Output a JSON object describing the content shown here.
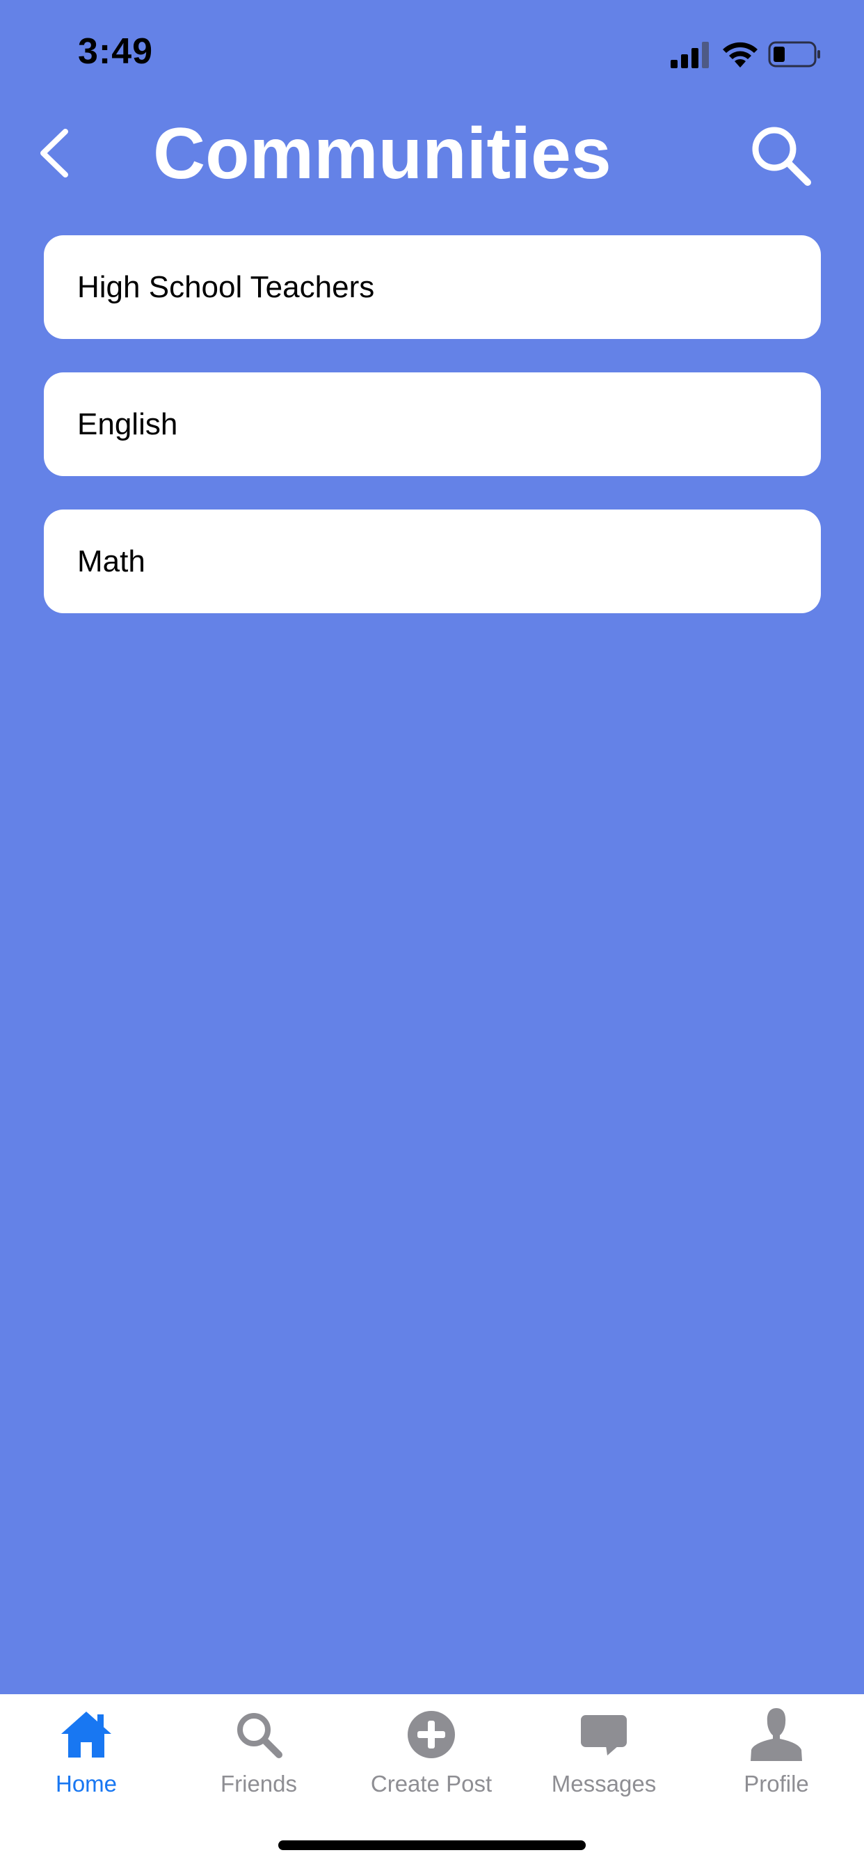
{
  "status_bar": {
    "time": "3:49",
    "icons": [
      "cellular-signal-icon",
      "wifi-icon",
      "battery-icon"
    ]
  },
  "header": {
    "back_icon": "chevron-left-icon",
    "title": "Communities",
    "search_icon": "search-icon"
  },
  "communities": [
    {
      "name": "High School Teachers"
    },
    {
      "name": "English"
    },
    {
      "name": "Math"
    }
  ],
  "tab_bar": {
    "tabs": [
      {
        "label": "Home",
        "icon": "home-icon",
        "active": true
      },
      {
        "label": "Friends",
        "icon": "search-icon",
        "active": false
      },
      {
        "label": "Create Post",
        "icon": "plus-circle-icon",
        "active": false
      },
      {
        "label": "Messages",
        "icon": "message-bubble-icon",
        "active": false
      },
      {
        "label": "Profile",
        "icon": "person-icon",
        "active": false
      }
    ]
  },
  "colors": {
    "background": "#6482e7",
    "active_tab": "#1877f2",
    "inactive_tab": "#8e8e93",
    "card": "#ffffff"
  }
}
